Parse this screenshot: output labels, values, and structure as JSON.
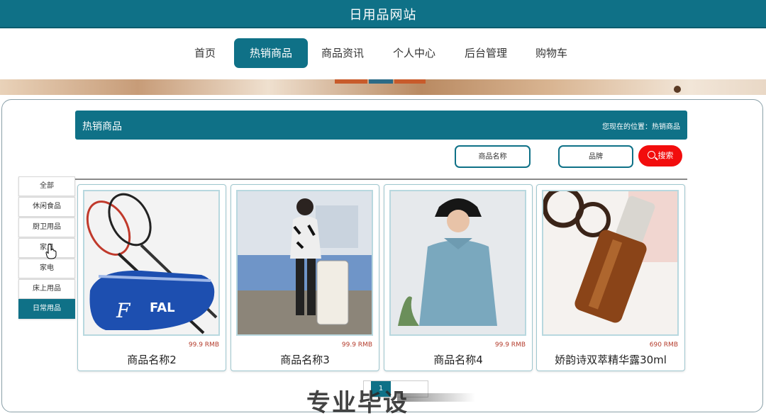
{
  "site": {
    "title": "日用品网站"
  },
  "nav": [
    {
      "label": "首页",
      "active": false
    },
    {
      "label": "热销商品",
      "active": true
    },
    {
      "label": "商品资讯",
      "active": false
    },
    {
      "label": "个人中心",
      "active": false
    },
    {
      "label": "后台管理",
      "active": false
    },
    {
      "label": "购物车",
      "active": false
    }
  ],
  "section": {
    "title": "热销商品",
    "location": "您现在的位置：热销商品"
  },
  "search": {
    "name_placeholder": "商品名称",
    "brand_placeholder": "品牌",
    "button_label": "搜索"
  },
  "categories": [
    {
      "label": "全部",
      "active": false
    },
    {
      "label": "休闲食品",
      "active": false
    },
    {
      "label": "厨卫用品",
      "active": false
    },
    {
      "label": "家具",
      "active": false
    },
    {
      "label": "家电",
      "active": false
    },
    {
      "label": "床上用品",
      "active": false
    },
    {
      "label": "日常用品",
      "active": true
    }
  ],
  "products": [
    {
      "name": "商品名称2",
      "price": "99.9 RMB",
      "image": "badminton-rackets-and-bag"
    },
    {
      "name": "商品名称3",
      "price": "99.9 RMB",
      "image": "woman-with-suitcase"
    },
    {
      "name": "商品名称4",
      "price": "99.9 RMB",
      "image": "woman-in-hoodie"
    },
    {
      "name": "娇韵诗双萃精华露30ml",
      "price": "690 RMB",
      "image": "serum-bottle-and-glasses"
    }
  ],
  "pagination": {
    "current": "1"
  },
  "watermark": "专业毕设",
  "colors": {
    "primary": "#0f7187",
    "accent": "#f20d0d",
    "price": "#b33a2a"
  }
}
